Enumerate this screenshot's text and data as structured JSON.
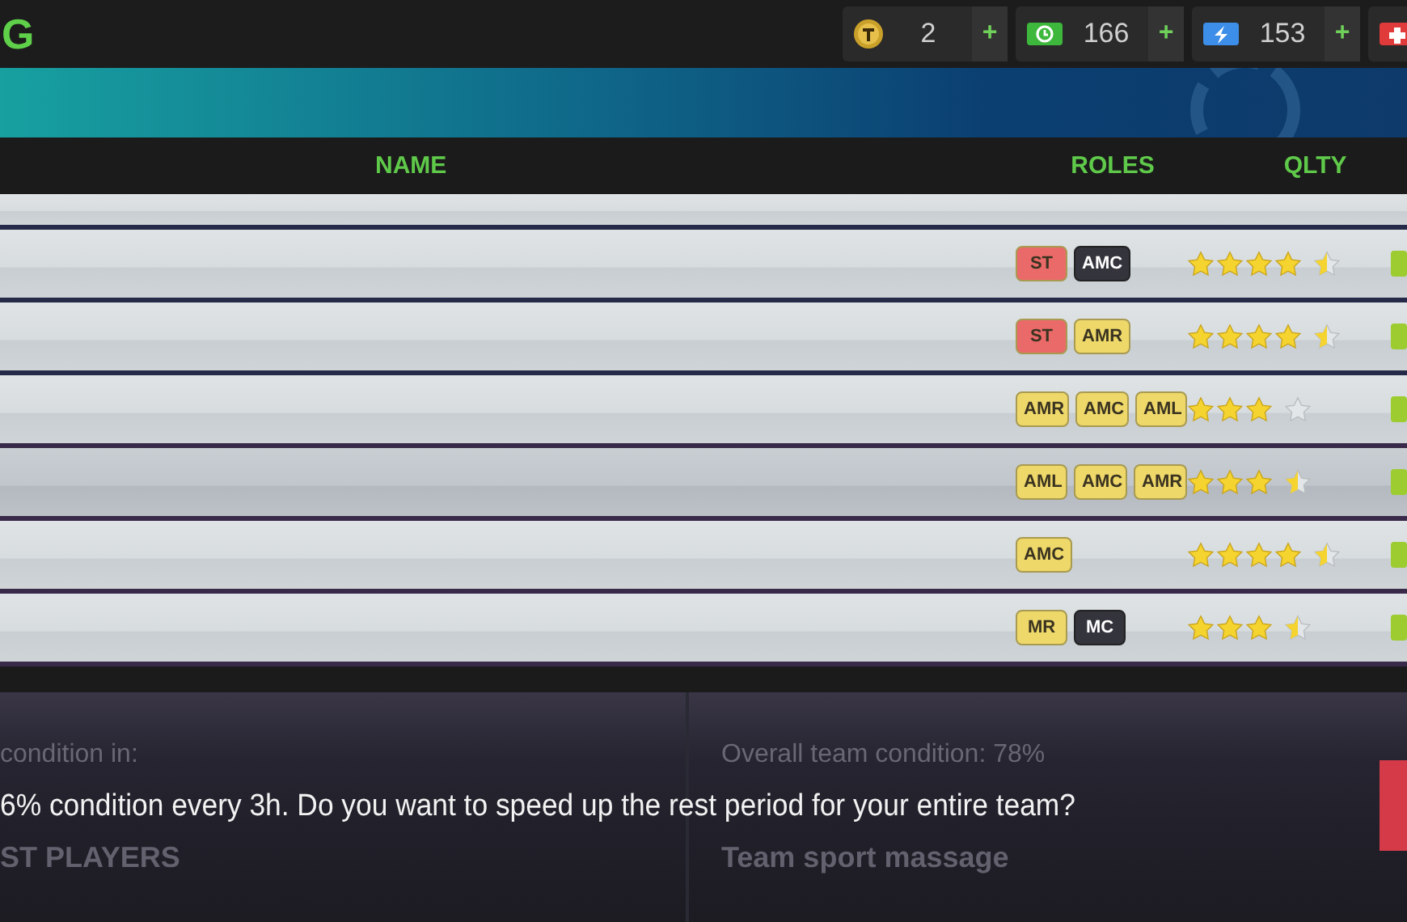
{
  "top_bar": {
    "title": "G",
    "currencies": [
      {
        "kind": "coin",
        "value": "2",
        "plus": "+"
      },
      {
        "kind": "cash",
        "value": "166",
        "plus": "+"
      },
      {
        "kind": "energy",
        "value": "153",
        "plus": "+"
      },
      {
        "kind": "medic"
      }
    ]
  },
  "table": {
    "columns": [
      "NAME",
      "ROLES",
      "QLTY"
    ],
    "rows": [
      {
        "roles": [
          {
            "label": "ST",
            "color": "#ea6a6a"
          },
          {
            "label": "AMC",
            "color": "#33343c"
          }
        ],
        "stars": 4.5,
        "selected": false
      },
      {
        "roles": [
          {
            "label": "ST",
            "color": "#ea6a6a"
          },
          {
            "label": "AMR",
            "color": "#eed86a"
          }
        ],
        "stars": 4.5,
        "selected": false
      },
      {
        "roles": [
          {
            "label": "AMR",
            "color": "#eed86a"
          },
          {
            "label": "AMC",
            "color": "#eed86a"
          },
          {
            "label": "AML",
            "color": "#eed86a"
          }
        ],
        "stars": 3,
        "selected": false
      },
      {
        "roles": [
          {
            "label": "AML",
            "color": "#eed86a"
          },
          {
            "label": "AMC",
            "color": "#eed86a"
          },
          {
            "label": "AMR",
            "color": "#eed86a"
          }
        ],
        "stars": 3.5,
        "selected": true
      },
      {
        "roles": [
          {
            "label": "AMC",
            "color": "#eed86a"
          }
        ],
        "stars": 4.5,
        "selected": false
      },
      {
        "roles": [
          {
            "label": "MR",
            "color": "#eed86a"
          },
          {
            "label": "MC",
            "color": "#33343c"
          }
        ],
        "stars": 3.5,
        "selected": false
      }
    ]
  },
  "behind": {
    "left_label": "condition in:",
    "left_heading": "ST PLAYERS",
    "right_label": "Overall team condition: 78%",
    "right_heading": "Team sport massage"
  },
  "dialog": {
    "message": "6% condition every 3h. Do you want to speed up the rest period for your entire team?"
  }
}
